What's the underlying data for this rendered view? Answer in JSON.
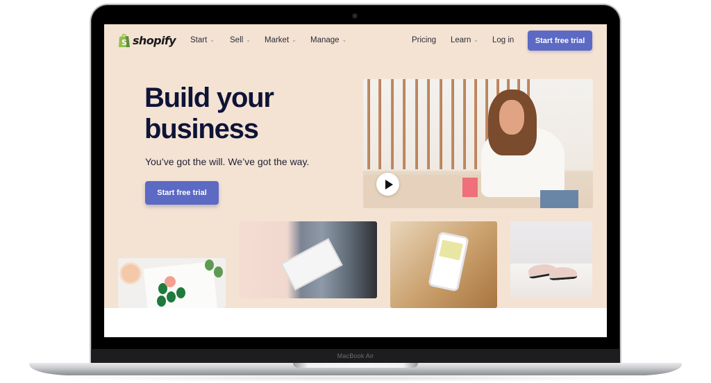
{
  "device": {
    "model_label": "MacBook Air"
  },
  "nav": {
    "logo_text": "shopify",
    "menu": [
      {
        "label": "Start",
        "has_dropdown": true
      },
      {
        "label": "Sell",
        "has_dropdown": true
      },
      {
        "label": "Market",
        "has_dropdown": true
      },
      {
        "label": "Manage",
        "has_dropdown": true
      }
    ],
    "right": [
      {
        "label": "Pricing",
        "has_dropdown": false
      },
      {
        "label": "Learn",
        "has_dropdown": true
      },
      {
        "label": "Log in",
        "has_dropdown": false
      }
    ],
    "cta_label": "Start free trial",
    "dropdown_icon": "chevron-down-icon"
  },
  "hero": {
    "title": "Build your business",
    "subtitle": "You’ve got the will. We’ve got the way.",
    "cta_label": "Start free trial",
    "video_play_icon": "play-icon"
  },
  "gallery": [
    {
      "name": "notebook-drawing-image"
    },
    {
      "name": "tablet-clothing-rack-image"
    },
    {
      "name": "phone-shopping-image"
    },
    {
      "name": "shoes-on-pedestal-image"
    }
  ],
  "colors": {
    "background": "#f4e3d3",
    "primary_button": "#5c6ac4",
    "heading": "#0e1337",
    "logo_green": "#95bf47"
  }
}
